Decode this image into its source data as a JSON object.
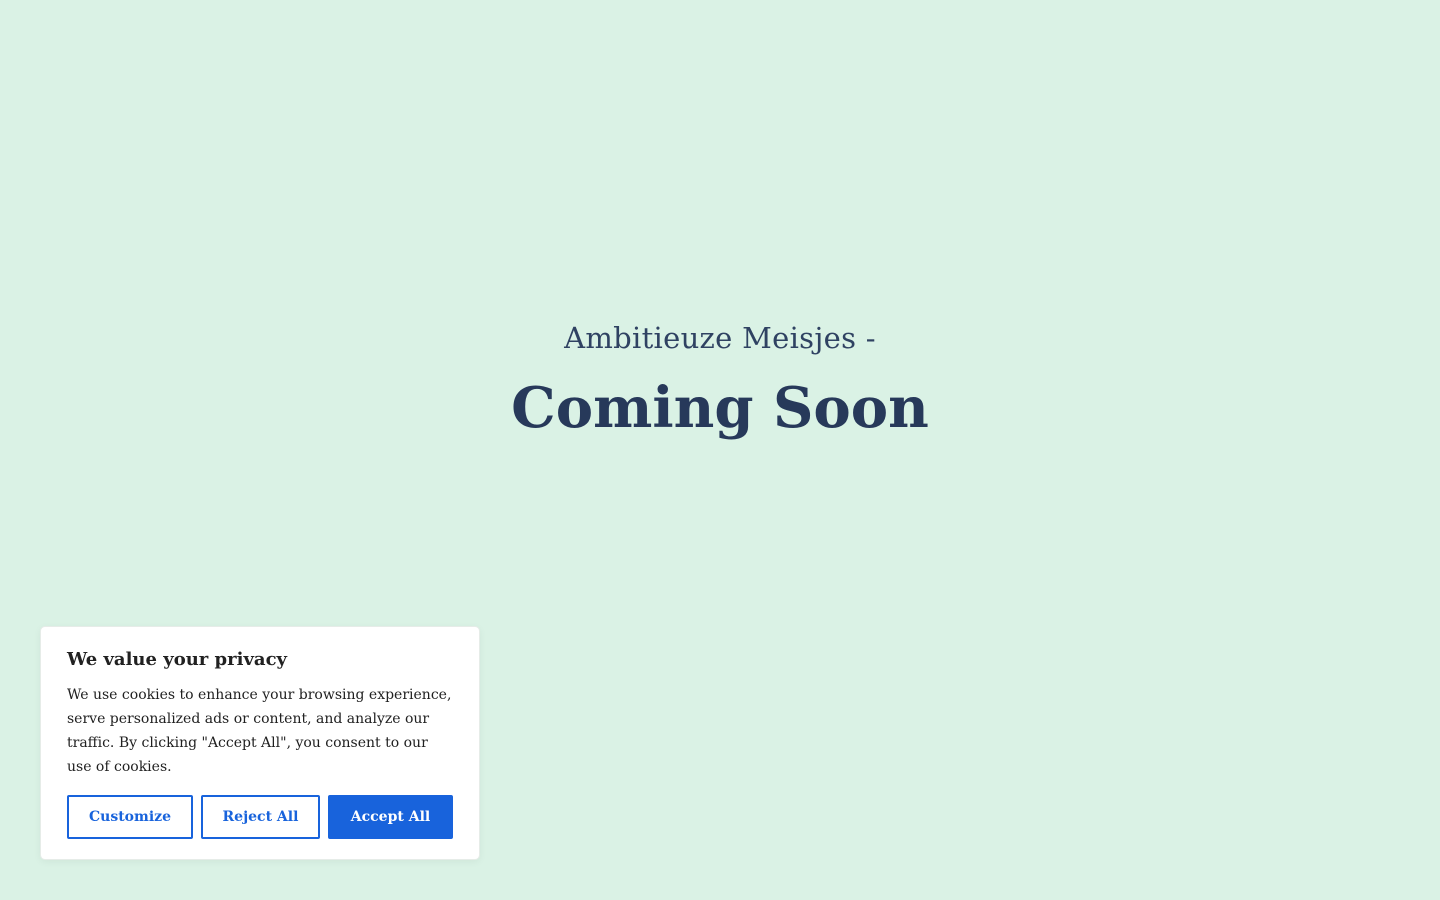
{
  "hero": {
    "subtitle": "Ambitieuze Meisjes -",
    "title": "Coming Soon"
  },
  "cookie_banner": {
    "title": "We value your privacy",
    "text": "We use cookies to enhance your browsing experience, serve personalized ads or content, and analyze our traffic. By clicking \"Accept All\", you consent to our use of cookies.",
    "buttons": {
      "customize": "Customize",
      "reject_all": "Reject All",
      "accept_all": "Accept All"
    }
  },
  "colors": {
    "page_background": "#daf2e5",
    "heading_text": "#27395a",
    "accent_blue": "#1863dc",
    "banner_background": "#ffffff"
  }
}
